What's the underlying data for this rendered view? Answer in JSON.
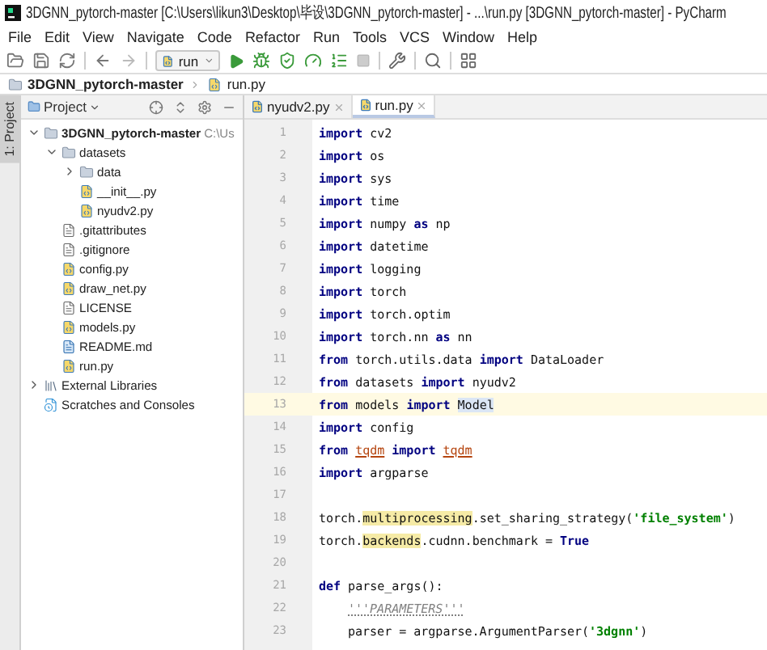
{
  "window": {
    "title": "3DGNN_pytorch-master [C:\\Users\\likun3\\Desktop\\毕设\\3DGNN_pytorch-master] - ...\\run.py [3DGNN_pytorch-master] - PyCharm"
  },
  "menu": [
    "File",
    "Edit",
    "View",
    "Navigate",
    "Code",
    "Refactor",
    "Run",
    "Tools",
    "VCS",
    "Window",
    "Help"
  ],
  "toolbar": {
    "run_configuration": "run"
  },
  "breadcrumb": [
    {
      "label": "3DGNN_pytorch-master",
      "kind": "folder"
    },
    {
      "label": "run.py",
      "kind": "python"
    }
  ],
  "side_tab": {
    "label": "1: Project",
    "selected": true
  },
  "project_panel": {
    "title": "Project",
    "tree": [
      {
        "label": "3DGNN_pytorch-master",
        "path": "C:\\Us",
        "kind": "folder",
        "expanded": true,
        "children": [
          {
            "label": "datasets",
            "kind": "folder",
            "expanded": true,
            "children": [
              {
                "label": "data",
                "kind": "folder",
                "expanded": false
              },
              {
                "label": "__init__.py",
                "kind": "python"
              },
              {
                "label": "nyudv2.py",
                "kind": "python"
              }
            ]
          },
          {
            "label": ".gitattributes",
            "kind": "text"
          },
          {
            "label": ".gitignore",
            "kind": "text"
          },
          {
            "label": "config.py",
            "kind": "python"
          },
          {
            "label": "draw_net.py",
            "kind": "python"
          },
          {
            "label": "LICENSE",
            "kind": "text"
          },
          {
            "label": "models.py",
            "kind": "python"
          },
          {
            "label": "README.md",
            "kind": "markdown"
          },
          {
            "label": "run.py",
            "kind": "python"
          }
        ]
      },
      {
        "label": "External Libraries",
        "kind": "libraries",
        "expanded": false
      },
      {
        "label": "Scratches and Consoles",
        "kind": "scratches"
      }
    ]
  },
  "editor": {
    "tabs": [
      {
        "label": "nyudv2.py",
        "selected": false
      },
      {
        "label": "run.py",
        "selected": true
      }
    ],
    "lines": [
      {
        "number": "1",
        "current": false,
        "tokens": [
          {
            "text": "import",
            "kind": "keyword"
          },
          {
            "text": " cv2",
            "kind": "text"
          }
        ]
      },
      {
        "number": "2",
        "current": false,
        "tokens": [
          {
            "text": "import",
            "kind": "keyword"
          },
          {
            "text": " os",
            "kind": "text"
          }
        ]
      },
      {
        "number": "3",
        "current": false,
        "tokens": [
          {
            "text": "import",
            "kind": "keyword"
          },
          {
            "text": " sys",
            "kind": "text"
          }
        ]
      },
      {
        "number": "4",
        "current": false,
        "tokens": [
          {
            "text": "import",
            "kind": "keyword"
          },
          {
            "text": " time",
            "kind": "text"
          }
        ]
      },
      {
        "number": "5",
        "current": false,
        "tokens": [
          {
            "text": "import",
            "kind": "keyword"
          },
          {
            "text": " numpy ",
            "kind": "text"
          },
          {
            "text": "as",
            "kind": "keyword"
          },
          {
            "text": " np",
            "kind": "text"
          }
        ]
      },
      {
        "number": "6",
        "current": false,
        "tokens": [
          {
            "text": "import",
            "kind": "keyword"
          },
          {
            "text": " datetime",
            "kind": "text"
          }
        ]
      },
      {
        "number": "7",
        "current": false,
        "tokens": [
          {
            "text": "import",
            "kind": "keyword"
          },
          {
            "text": " logging",
            "kind": "text"
          }
        ]
      },
      {
        "number": "8",
        "current": false,
        "tokens": [
          {
            "text": "import",
            "kind": "keyword"
          },
          {
            "text": " torch",
            "kind": "text"
          }
        ]
      },
      {
        "number": "9",
        "current": false,
        "tokens": [
          {
            "text": "import",
            "kind": "keyword"
          },
          {
            "text": " torch.optim",
            "kind": "text"
          }
        ]
      },
      {
        "number": "10",
        "current": false,
        "tokens": [
          {
            "text": "import",
            "kind": "keyword"
          },
          {
            "text": " torch.nn ",
            "kind": "text"
          },
          {
            "text": "as",
            "kind": "keyword"
          },
          {
            "text": " nn",
            "kind": "text"
          }
        ]
      },
      {
        "number": "11",
        "current": false,
        "tokens": [
          {
            "text": "from",
            "kind": "keyword"
          },
          {
            "text": " torch.utils.data ",
            "kind": "text"
          },
          {
            "text": "import",
            "kind": "keyword"
          },
          {
            "text": " DataLoader",
            "kind": "text"
          }
        ]
      },
      {
        "number": "12",
        "current": false,
        "tokens": [
          {
            "text": "from",
            "kind": "keyword"
          },
          {
            "text": " datasets ",
            "kind": "text"
          },
          {
            "text": "import",
            "kind": "keyword"
          },
          {
            "text": " nyudv2",
            "kind": "text"
          }
        ]
      },
      {
        "number": "13",
        "current": true,
        "tokens": [
          {
            "text": "from",
            "kind": "keyword"
          },
          {
            "text": " models ",
            "kind": "text"
          },
          {
            "text": "import ",
            "kind": "keyword"
          },
          {
            "text": "Model",
            "kind": "reference"
          }
        ]
      },
      {
        "number": "14",
        "current": false,
        "tokens": [
          {
            "text": "import",
            "kind": "keyword"
          },
          {
            "text": " config",
            "kind": "text"
          }
        ]
      },
      {
        "number": "15",
        "current": false,
        "tokens": [
          {
            "text": "from ",
            "kind": "keyword"
          },
          {
            "text": "tqdm",
            "kind": "unresolved"
          },
          {
            "text": " import ",
            "kind": "keyword"
          },
          {
            "text": "tqdm",
            "kind": "unresolved"
          }
        ]
      },
      {
        "number": "16",
        "current": false,
        "tokens": [
          {
            "text": "import",
            "kind": "keyword"
          },
          {
            "text": " argparse",
            "kind": "text"
          }
        ]
      },
      {
        "number": "17",
        "current": false
      },
      {
        "number": "18",
        "current": false,
        "tokens": [
          {
            "text": "torch.",
            "kind": "text"
          },
          {
            "text": "multiprocessing",
            "kind": "warning"
          },
          {
            "text": ".set_sharing_strategy(",
            "kind": "text"
          },
          {
            "text": "'file_system'",
            "kind": "string"
          },
          {
            "text": ")",
            "kind": "text"
          }
        ]
      },
      {
        "number": "19",
        "current": false,
        "tokens": [
          {
            "text": "torch.",
            "kind": "text"
          },
          {
            "text": "backends",
            "kind": "warning"
          },
          {
            "text": ".cudnn.benchmark = ",
            "kind": "text"
          },
          {
            "text": "True",
            "kind": "keyword"
          }
        ]
      },
      {
        "number": "20",
        "current": false
      },
      {
        "number": "21",
        "current": false,
        "tokens": [
          {
            "text": "def",
            "kind": "keyword"
          },
          {
            "text": " parse_args():",
            "kind": "text"
          }
        ],
        "children": [
          {
            "number": "22",
            "current": false,
            "tokens": [
              {
                "text": "'''PARAMETERS'''",
                "kind": "docstring"
              }
            ]
          },
          {
            "number": "23",
            "current": false,
            "tokens": [
              {
                "text": "parser = argparse.ArgumentParser(",
                "kind": "text"
              },
              {
                "text": "'3dgnn'",
                "kind": "string"
              },
              {
                "text": ")",
                "kind": "text"
              }
            ]
          }
        ]
      }
    ]
  }
}
